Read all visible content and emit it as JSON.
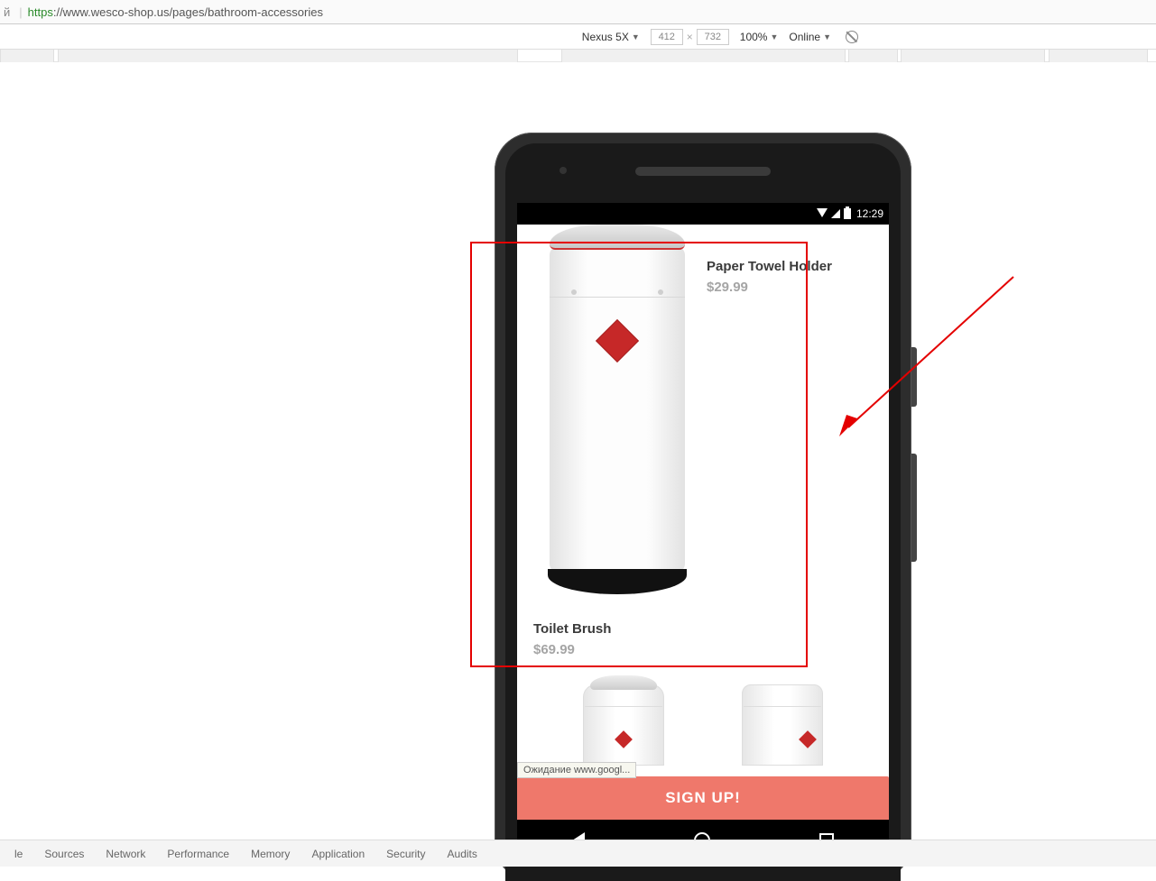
{
  "browser": {
    "url_prefix": "й",
    "url_scheme": "https",
    "url_rest": "://www.wesco-shop.us/pages/bathroom-accessories"
  },
  "devtools": {
    "device": "Nexus 5X",
    "width": "412",
    "height": "732",
    "zoom": "100%",
    "throttle": "Online",
    "tabs": [
      "le",
      "Sources",
      "Network",
      "Performance",
      "Memory",
      "Application",
      "Security",
      "Audits"
    ]
  },
  "status_bar": {
    "time": "12:29"
  },
  "products": {
    "paper_towel": {
      "name": "Paper Towel Holder",
      "price": "$29.99"
    },
    "toilet_brush": {
      "name": "Toilet Brush",
      "price": "$69.99"
    }
  },
  "signup_label": "SIGN UP!",
  "loading_text": "Ожидание www.googl..."
}
